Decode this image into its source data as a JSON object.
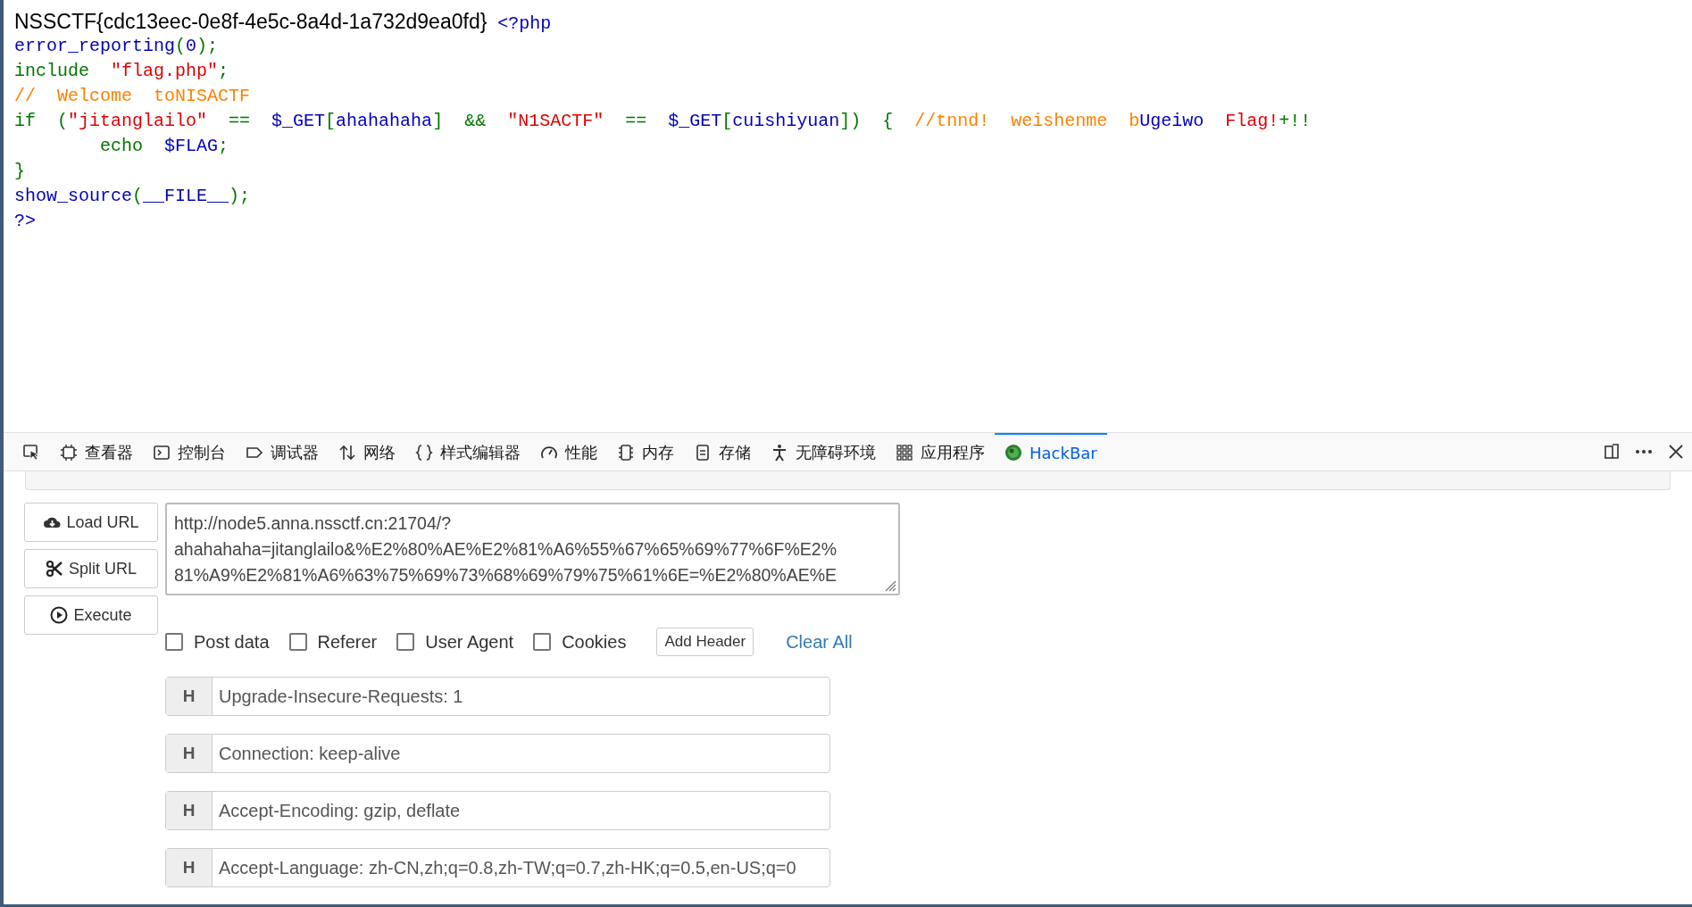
{
  "source": {
    "lines": [
      {
        "tokens": [
          {
            "kind": "output",
            "text": "NSSCTF{cdc13eec-0e8f-4e5c-8a4d-1a732d9ea0fd}"
          },
          {
            "kind": "default",
            "text": " <?php"
          }
        ]
      },
      {
        "tokens": [
          {
            "kind": "default",
            "text": "error_reporting"
          },
          {
            "kind": "keyword",
            "text": "("
          },
          {
            "kind": "default",
            "text": "0"
          },
          {
            "kind": "keyword",
            "text": ");"
          }
        ]
      },
      {
        "tokens": [
          {
            "kind": "keyword",
            "text": "include  "
          },
          {
            "kind": "string",
            "text": "\"flag.php\""
          },
          {
            "kind": "keyword",
            "text": ";"
          }
        ]
      },
      {
        "tokens": [
          {
            "kind": "comment",
            "text": "//  Welcome  toNISACTF"
          }
        ]
      },
      {
        "tokens": [
          {
            "kind": "keyword",
            "text": "if  ("
          },
          {
            "kind": "string",
            "text": "\"jitanglailo\""
          },
          {
            "kind": "keyword",
            "text": "  ==  "
          },
          {
            "kind": "default",
            "text": "$_GET"
          },
          {
            "kind": "keyword",
            "text": "["
          },
          {
            "kind": "default",
            "text": "ahahahaha"
          },
          {
            "kind": "keyword",
            "text": "]  &&  "
          },
          {
            "kind": "string",
            "text": "\"N1SACTF\""
          },
          {
            "kind": "keyword",
            "text": "  ==  "
          },
          {
            "kind": "default",
            "text": "$_GET"
          },
          {
            "kind": "keyword",
            "text": "["
          },
          {
            "kind": "default",
            "text": "cuishiyuan"
          },
          {
            "kind": "keyword",
            "text": "])  {  "
          },
          {
            "kind": "comment",
            "text": "//tnnd!  weishenme  b"
          },
          {
            "kind": "default",
            "text": "Ugeiwo  "
          },
          {
            "kind": "string",
            "text": "Flag!"
          },
          {
            "kind": "keyword",
            "text": "+!!"
          }
        ]
      },
      {
        "indented": true,
        "tokens": [
          {
            "kind": "keyword",
            "text": "echo  "
          },
          {
            "kind": "default",
            "text": "$FLAG"
          },
          {
            "kind": "keyword",
            "text": ";"
          }
        ]
      },
      {
        "tokens": [
          {
            "kind": "keyword",
            "text": "}"
          }
        ]
      },
      {
        "tokens": [
          {
            "kind": "default",
            "text": "show_source"
          },
          {
            "kind": "keyword",
            "text": "("
          },
          {
            "kind": "default",
            "text": "__FILE__"
          },
          {
            "kind": "keyword",
            "text": ");"
          }
        ]
      },
      {
        "tokens": [
          {
            "kind": "default",
            "text": "?>"
          }
        ]
      }
    ]
  },
  "devtools": {
    "tools": [
      {
        "selected": false
      },
      {
        "label": "查看器",
        "selected": false
      },
      {
        "label": "控制台",
        "selected": false
      },
      {
        "label": "调试器",
        "selected": false
      },
      {
        "label": "网络",
        "selected": false
      },
      {
        "label": "样式编辑器",
        "selected": false
      },
      {
        "label": "性能",
        "selected": false
      },
      {
        "label": "内存",
        "selected": false
      },
      {
        "label": "存储",
        "selected": false
      },
      {
        "label": "无障碍环境",
        "selected": false
      },
      {
        "label": "应用程序",
        "selected": false
      },
      {
        "label": "HackBar",
        "selected": true
      }
    ]
  },
  "hackbar": {
    "buttons": [
      {
        "label": "Load URL"
      },
      {
        "label": "Split URL"
      },
      {
        "label": "Execute"
      }
    ],
    "url_lines": [
      "http://node5.anna.nssctf.cn:21704/?",
      "ahahahaha=jitanglailo&%E2%80%AE%E2%81%A6%55%67%65%69%77%6F%E2%",
      "81%A9%E2%81%A6%63%75%69%73%68%69%79%75%61%6E=%E2%80%AE%E"
    ],
    "options": [
      {
        "label": "Post data",
        "checked": false
      },
      {
        "label": "Referer",
        "checked": false
      },
      {
        "label": "User Agent",
        "checked": false
      },
      {
        "label": "Cookies",
        "checked": false
      }
    ],
    "add_header": "Add Header",
    "clear_all": "Clear All",
    "headers": [
      {
        "tag": "H",
        "value": "Upgrade-Insecure-Requests: 1"
      },
      {
        "tag": "H",
        "value": "Connection: keep-alive"
      },
      {
        "tag": "H",
        "value": "Accept-Encoding: gzip, deflate"
      },
      {
        "tag": "H",
        "value": "Accept-Language: zh-CN,zh;q=0.8,zh-TW;q=0.7,zh-HK;q=0.5,en-US;q=0"
      }
    ]
  }
}
